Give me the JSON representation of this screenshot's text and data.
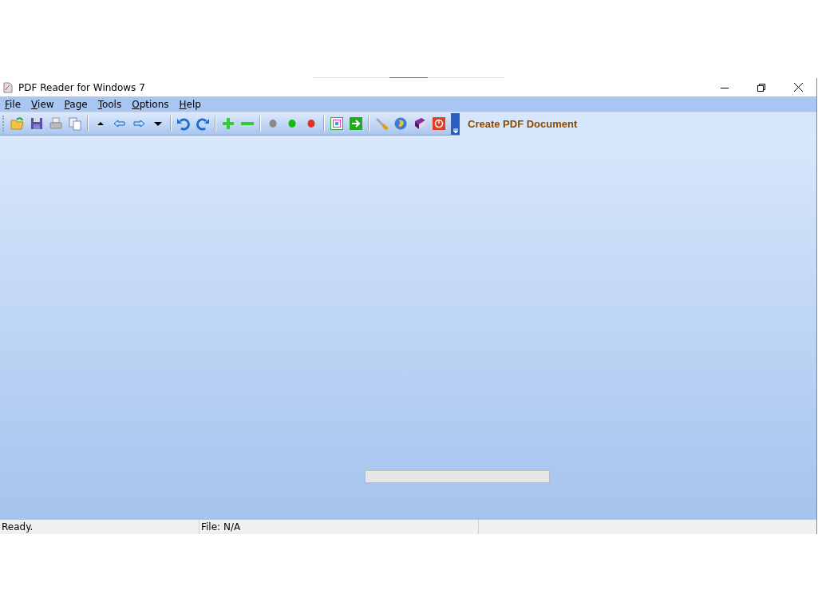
{
  "window": {
    "title": "PDF Reader for Windows 7"
  },
  "menu": [
    {
      "label": "File"
    },
    {
      "label": "View"
    },
    {
      "label": "Page"
    },
    {
      "label": "Tools"
    },
    {
      "label": "Options"
    },
    {
      "label": "Help"
    }
  ],
  "toolbar": {
    "link": "Create PDF Document"
  },
  "progress": {
    "level": 0
  },
  "status_bar": [
    {
      "text": "Ready."
    },
    {
      "text": "File: N/A"
    }
  ]
}
